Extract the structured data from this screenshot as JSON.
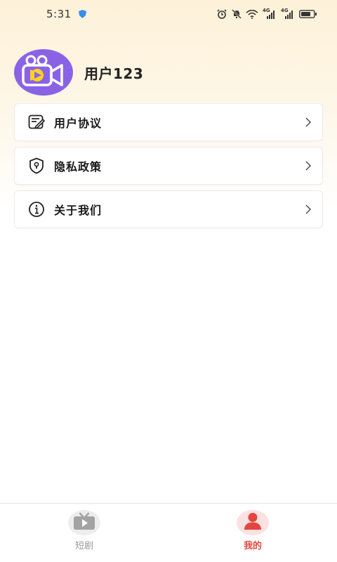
{
  "status_bar": {
    "time": "5:31",
    "network_1": "4G",
    "network_2": "4G"
  },
  "profile": {
    "username": "用户123",
    "avatar_icon": "video-camera-icon",
    "avatar_color": "#8a63e5"
  },
  "menu": {
    "items": [
      {
        "label": "用户协议",
        "icon": "agreement-icon"
      },
      {
        "label": "隐私政策",
        "icon": "privacy-shield-icon"
      },
      {
        "label": "关于我们",
        "icon": "info-icon"
      }
    ]
  },
  "bottom_nav": {
    "tabs": [
      {
        "label": "短剧",
        "icon": "tv-play-icon",
        "active": false
      },
      {
        "label": "我的",
        "icon": "user-icon",
        "active": true
      }
    ]
  },
  "colors": {
    "accent": "#e4453f",
    "avatar": "#8a63e5",
    "header_gradient": "#fdf1d8"
  }
}
